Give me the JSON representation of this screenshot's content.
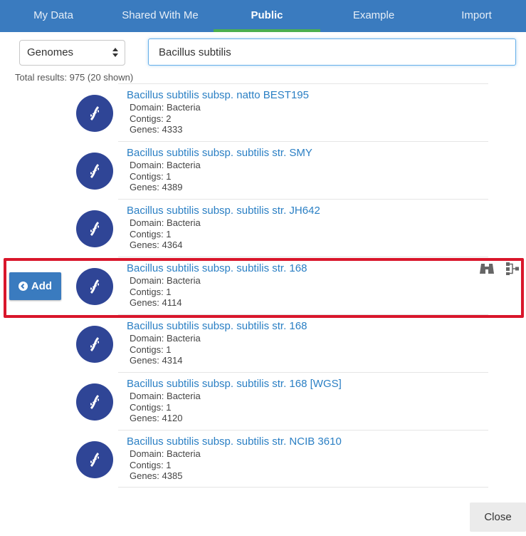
{
  "tabs": [
    {
      "label": "My Data",
      "active": false
    },
    {
      "label": "Shared With Me",
      "active": false
    },
    {
      "label": "Public",
      "active": true
    },
    {
      "label": "Example",
      "active": false
    },
    {
      "label": "Import",
      "active": false
    }
  ],
  "filter": {
    "type_value": "Genomes",
    "search_value": "Bacillus subtilis"
  },
  "total_results": "Total results: 975 (20 shown)",
  "results": [
    {
      "name": "Bacillus subtilis subsp. natto BEST195",
      "domain": "Domain: Bacteria",
      "contigs": "Contigs: 2",
      "genes": "Genes: 4333"
    },
    {
      "name": "Bacillus subtilis subsp. subtilis str. SMY",
      "domain": "Domain: Bacteria",
      "contigs": "Contigs: 1",
      "genes": "Genes: 4389"
    },
    {
      "name": "Bacillus subtilis subsp. subtilis str. JH642",
      "domain": "Domain: Bacteria",
      "contigs": "Contigs: 1",
      "genes": "Genes: 4364"
    },
    {
      "name": "Bacillus subtilis subsp. subtilis str. 168",
      "domain": "Domain: Bacteria",
      "contigs": "Contigs: 1",
      "genes": "Genes: 4114"
    },
    {
      "name": "Bacillus subtilis subsp. subtilis str. 168",
      "domain": "Domain: Bacteria",
      "contigs": "Contigs: 1",
      "genes": "Genes: 4314"
    },
    {
      "name": "Bacillus subtilis subsp. subtilis str. 168 [WGS]",
      "domain": "Domain: Bacteria",
      "contigs": "Contigs: 1",
      "genes": "Genes: 4120"
    },
    {
      "name": "Bacillus subtilis subsp. subtilis str. NCIB 3610",
      "domain": "Domain: Bacteria",
      "contigs": "Contigs: 1",
      "genes": "Genes: 4385"
    }
  ],
  "highlighted_row_actions": {
    "add_label": "Add",
    "icons": [
      "binoculars-icon",
      "tree-icon"
    ]
  },
  "footer": {
    "close_label": "Close"
  },
  "colors": {
    "header": "#3a7bbf",
    "active_tab_underline": "#4caf50",
    "link": "#2a7fc4",
    "avatar": "#2f4596",
    "highlight_border": "#d9162b"
  }
}
